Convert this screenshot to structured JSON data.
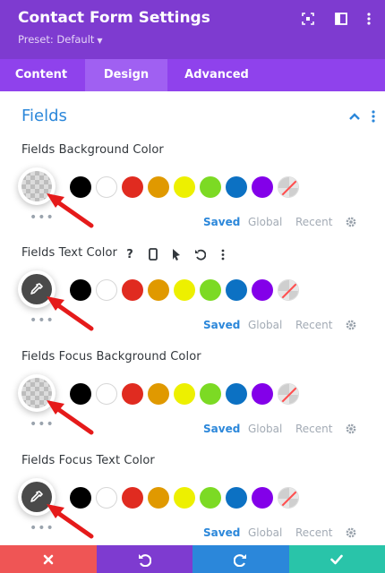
{
  "header": {
    "title": "Contact Form Settings",
    "preset": "Preset: Default"
  },
  "tabs": [
    {
      "label": "Content",
      "active": false
    },
    {
      "label": "Design",
      "active": true
    },
    {
      "label": "Advanced",
      "active": false
    }
  ],
  "section": {
    "title": "Fields"
  },
  "palette": [
    "#000000",
    "#ffffff",
    "#e02b20",
    "#e09900",
    "#edf000",
    "#7cda24",
    "#0c71c3",
    "#8300e9"
  ],
  "swatch_tabs": {
    "saved": "Saved",
    "global": "Global",
    "recent": "Recent"
  },
  "fields": [
    {
      "label": "Fields Background Color",
      "current": "transparent"
    },
    {
      "label": "Fields Text Color",
      "current": "eyedropper",
      "hovered": true
    },
    {
      "label": "Fields Focus Background Color",
      "current": "transparent"
    },
    {
      "label": "Fields Focus Text Color",
      "current": "eyedropper"
    }
  ],
  "tool_icons": [
    "help-icon",
    "mobile-icon",
    "cursor-icon",
    "reset-icon",
    "more-icon"
  ],
  "footer": {
    "buttons": [
      {
        "name": "discard",
        "color": "#ef5555"
      },
      {
        "name": "undo",
        "color": "#7e3bd0"
      },
      {
        "name": "redo",
        "color": "#2b87da"
      },
      {
        "name": "save",
        "color": "#29c4a9"
      }
    ]
  },
  "colors": {
    "header": "#7e3bd0",
    "tabs": "#8f42ec",
    "accent": "#2b87da",
    "arrow": "#e51a1a"
  }
}
